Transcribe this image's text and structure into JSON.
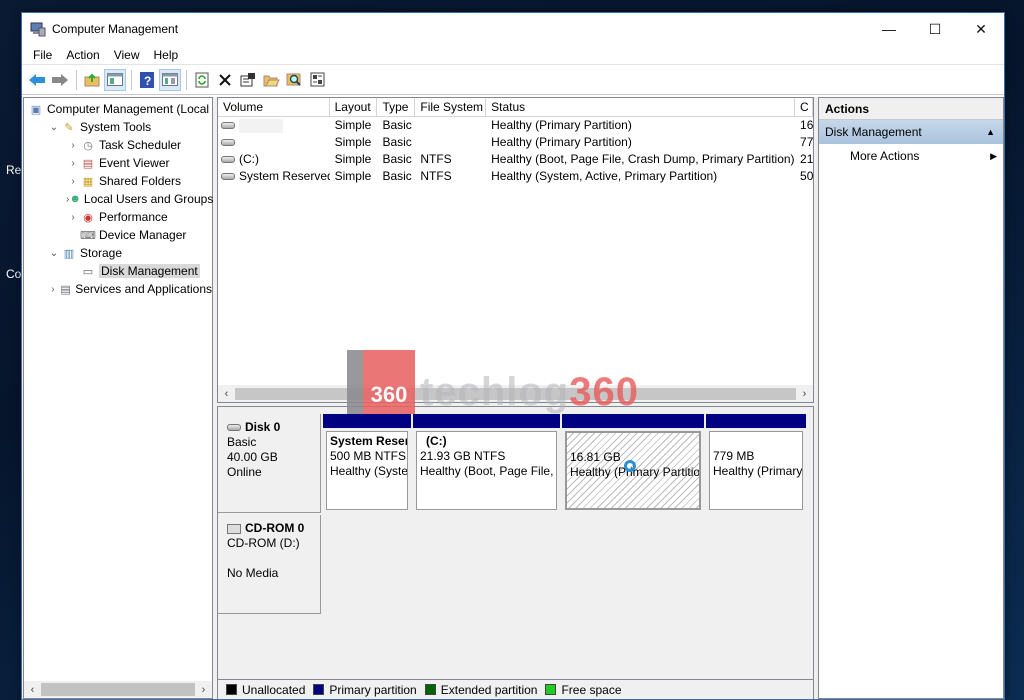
{
  "desktop": {
    "labels": [
      "Re",
      "Co"
    ]
  },
  "window": {
    "title": "Computer Management",
    "controls": {
      "minimize": "—",
      "maximize": "☐",
      "close": "✕"
    }
  },
  "menu": [
    "File",
    "Action",
    "View",
    "Help"
  ],
  "toolbar": {
    "icons": [
      "back-arrow-icon",
      "forward-arrow-icon",
      "up-folder-icon",
      "show-hide-tree-icon",
      "help-icon",
      "show-hide-action-pane-icon",
      "refresh-icon",
      "delete-icon",
      "properties-icon",
      "open-icon",
      "search-icon",
      "settings-icon"
    ]
  },
  "tree": {
    "items": [
      {
        "label": "Computer Management (Local",
        "level": 0,
        "expander": "",
        "icon": "computer-management-icon"
      },
      {
        "label": "System Tools",
        "level": 1,
        "expander": "v",
        "icon": "tools-icon"
      },
      {
        "label": "Task Scheduler",
        "level": 2,
        "expander": ">",
        "icon": "clock-icon"
      },
      {
        "label": "Event Viewer",
        "level": 2,
        "expander": ">",
        "icon": "event-viewer-icon"
      },
      {
        "label": "Shared Folders",
        "level": 2,
        "expander": ">",
        "icon": "shared-folder-icon"
      },
      {
        "label": "Local Users and Groups",
        "level": 2,
        "expander": ">",
        "icon": "users-icon"
      },
      {
        "label": "Performance",
        "level": 2,
        "expander": ">",
        "icon": "performance-icon"
      },
      {
        "label": "Device Manager",
        "level": 2,
        "expander": "",
        "icon": "device-manager-icon"
      },
      {
        "label": "Storage",
        "level": 1,
        "expander": "v",
        "icon": "storage-icon"
      },
      {
        "label": "Disk Management",
        "level": 2,
        "expander": "",
        "icon": "disk-management-icon",
        "selected": true
      },
      {
        "label": "Services and Applications",
        "level": 1,
        "expander": ">",
        "icon": "services-icon"
      }
    ]
  },
  "volumes": {
    "columns": [
      "Volume",
      "Layout",
      "Type",
      "File System",
      "Status",
      "C"
    ],
    "rows": [
      {
        "volume": "",
        "layout": "Simple",
        "type": "Basic",
        "fs": "",
        "status": "Healthy (Primary Partition)",
        "cap": "16"
      },
      {
        "volume": "",
        "layout": "Simple",
        "type": "Basic",
        "fs": "",
        "status": "Healthy (Primary Partition)",
        "cap": "77"
      },
      {
        "volume": "(C:)",
        "layout": "Simple",
        "type": "Basic",
        "fs": "NTFS",
        "status": "Healthy (Boot, Page File, Crash Dump, Primary Partition)",
        "cap": "21"
      },
      {
        "volume": "System Reserved",
        "layout": "Simple",
        "type": "Basic",
        "fs": "NTFS",
        "status": "Healthy (System, Active, Primary Partition)",
        "cap": "50"
      }
    ]
  },
  "disks": [
    {
      "name": "Disk 0",
      "type": "Basic",
      "size": "40.00 GB",
      "state": "Online",
      "partitions": [
        {
          "title": "System Reser",
          "size": "500 MB NTFS",
          "status": "Healthy (Syste",
          "color": "#000080"
        },
        {
          "title": "(C:)",
          "size": "21.93 GB NTFS",
          "status": "Healthy (Boot, Page File,",
          "color": "#000080"
        },
        {
          "title": "",
          "size": "16.81 GB",
          "status": "Healthy (Primary Partitio",
          "color": "#000080",
          "selected": true
        },
        {
          "title": "",
          "size": "779 MB",
          "status": "Healthy (Primary",
          "color": "#000080"
        }
      ]
    },
    {
      "name": "CD-ROM 0",
      "type": "CD-ROM (D:)",
      "size": "",
      "state": "No Media"
    }
  ],
  "legend": [
    {
      "label": "Unallocated",
      "color": "#000000"
    },
    {
      "label": "Primary partition",
      "color": "#000080"
    },
    {
      "label": "Extended partition",
      "color": "#006400"
    },
    {
      "label": "Free space",
      "color": "#22cc22"
    }
  ],
  "actions": {
    "header": "Actions",
    "group": "Disk Management",
    "items": [
      "More Actions"
    ]
  },
  "watermark": {
    "badge": "360",
    "text_pale": "techlog",
    "text_accent": "360"
  }
}
